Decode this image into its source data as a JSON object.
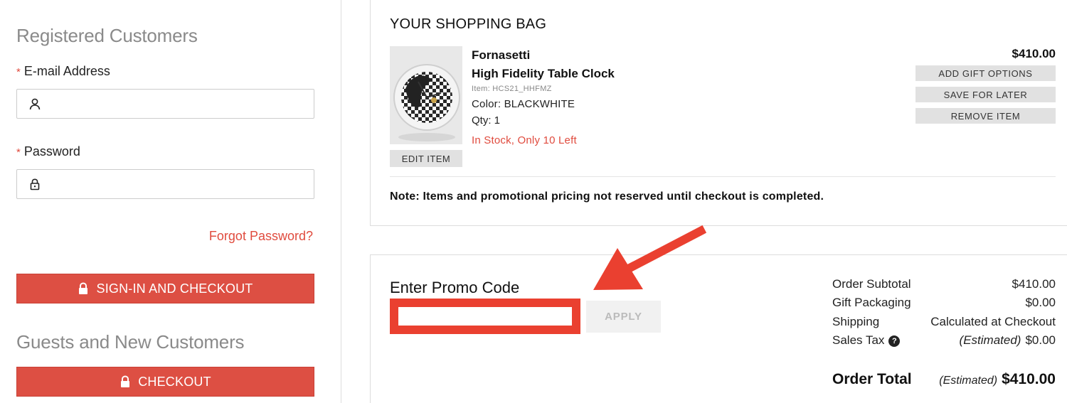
{
  "left": {
    "registered_heading": "Registered Customers",
    "email_label": "E-mail Address",
    "email_value": "",
    "password_label": "Password",
    "password_value": "",
    "required_marker": "*",
    "forgot_password": "Forgot Password?",
    "signin_button": "SIGN-IN AND CHECKOUT",
    "guests_heading": "Guests and New Customers",
    "checkout_button": "CHECKOUT"
  },
  "bag": {
    "title": "YOUR SHOPPING BAG",
    "item": {
      "brand": "Fornasetti",
      "name": "High Fidelity Table Clock",
      "item_no": "Item: HCS21_HHFMZ",
      "color": "Color: BLACKWHITE",
      "qty": "Qty: 1",
      "stock": "In Stock, Only 10 Left",
      "price": "$410.00",
      "edit_button": "EDIT ITEM"
    },
    "actions": {
      "gift": "ADD GIFT OPTIONS",
      "save": "SAVE FOR LATER",
      "remove": "REMOVE ITEM"
    },
    "note": "Note: Items and promotional pricing not reserved until checkout is completed."
  },
  "promo": {
    "title": "Enter Promo Code",
    "value": "",
    "apply_button": "APPLY"
  },
  "summary": {
    "subtotal_label": "Order Subtotal",
    "subtotal_value": "$410.00",
    "gift_label": "Gift Packaging",
    "gift_value": "$0.00",
    "shipping_label": "Shipping",
    "shipping_value": "Calculated at Checkout",
    "tax_label": "Sales Tax",
    "tax_help": "?",
    "tax_estimated": "(Estimated)",
    "tax_value": "$0.00",
    "total_label": "Order Total",
    "total_estimated": "(Estimated)",
    "total_value": "$410.00"
  },
  "colors": {
    "accent_red": "#dd4f43",
    "highlight_red": "#ea4030"
  },
  "icons": [
    "user-icon",
    "lock-icon",
    "padlock-icon",
    "help-icon",
    "arrow-annotation"
  ]
}
